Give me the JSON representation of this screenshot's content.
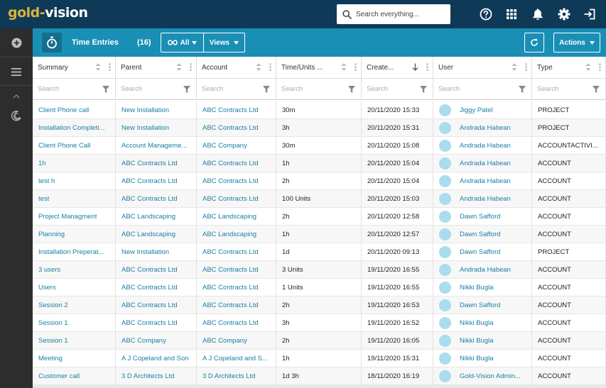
{
  "brand": {
    "part1": "gold",
    "dash": "-",
    "part2": "vision"
  },
  "search": {
    "placeholder": "Search everything..."
  },
  "topbar_icons": [
    "help-icon",
    "apps-grid-icon",
    "notifications-bell-icon",
    "settings-gear-icon",
    "logout-icon"
  ],
  "rail_icons": [
    "add-icon",
    "menu-hamburger-icon",
    "collapse-chevron-icon",
    "moon-icon"
  ],
  "header": {
    "title": "Time Entries",
    "count": "(16)",
    "filter_label": "All",
    "views_label": "Views",
    "actions_label": "Actions"
  },
  "columns": [
    {
      "key": "summary",
      "label": "Summary",
      "filter_placeholder": "Search"
    },
    {
      "key": "parent",
      "label": "Parent",
      "filter_placeholder": "Search"
    },
    {
      "key": "account",
      "label": "Account",
      "filter_placeholder": "Search"
    },
    {
      "key": "units",
      "label": "Time/Units ...",
      "filter_placeholder": "Search"
    },
    {
      "key": "created",
      "label": "Create...",
      "filter_placeholder": "Search",
      "sorted": "desc"
    },
    {
      "key": "user",
      "label": "User",
      "filter_placeholder": "Search"
    },
    {
      "key": "type",
      "label": "Type",
      "filter_placeholder": "Search"
    }
  ],
  "rows": [
    {
      "summary": "Client Phone call",
      "parent": "New Installation",
      "account": "ABC Contracts Ltd",
      "units": "30m",
      "created": "20/11/2020 15:33",
      "user": "Jiggy Patel",
      "type": "PROJECT"
    },
    {
      "summary": "Installation Completi...",
      "parent": "New Installation",
      "account": "ABC Contracts Ltd",
      "units": "3h",
      "created": "20/11/2020 15:31",
      "user": "Andrada Habean",
      "type": "PROJECT"
    },
    {
      "summary": "Client Phone Call",
      "parent": "Account Manageme...",
      "account": "ABC Company",
      "units": "30m",
      "created": "20/11/2020 15:08",
      "user": "Andrada Habean",
      "type": "ACCOUNTACTIVI..."
    },
    {
      "summary": "1h",
      "parent": "ABC Contracts Ltd",
      "account": "ABC Contracts Ltd",
      "units": "1h",
      "created": "20/11/2020 15:04",
      "user": "Andrada Habean",
      "type": "ACCOUNT"
    },
    {
      "summary": "test h",
      "parent": "ABC Contracts Ltd",
      "account": "ABC Contracts Ltd",
      "units": "2h",
      "created": "20/11/2020 15:04",
      "user": "Andrada Habean",
      "type": "ACCOUNT"
    },
    {
      "summary": "test",
      "parent": "ABC Contracts Ltd",
      "account": "ABC Contracts Ltd",
      "units": "100 Units",
      "created": "20/11/2020 15:03",
      "user": "Andrada Habean",
      "type": "ACCOUNT"
    },
    {
      "summary": "Project Managment",
      "parent": "ABC Landscaping",
      "account": "ABC Landscaping",
      "units": "2h",
      "created": "20/11/2020 12:58",
      "user": "Dawn Safford",
      "type": "ACCOUNT"
    },
    {
      "summary": "Planning",
      "parent": "ABC Landscaping",
      "account": "ABC Landscaping",
      "units": "1h",
      "created": "20/11/2020 12:57",
      "user": "Dawn Safford",
      "type": "ACCOUNT"
    },
    {
      "summary": "Installation Preperat...",
      "parent": "New Installation",
      "account": "ABC Contracts Ltd",
      "units": "1d",
      "created": "20/11/2020 09:13",
      "user": "Dawn Safford",
      "type": "PROJECT"
    },
    {
      "summary": "3 users",
      "parent": "ABC Contracts Ltd",
      "account": "ABC Contracts Ltd",
      "units": "3 Units",
      "created": "19/11/2020 16:55",
      "user": "Andrada Habean",
      "type": "ACCOUNT"
    },
    {
      "summary": "Users",
      "parent": "ABC Contracts Ltd",
      "account": "ABC Contracts Ltd",
      "units": "1 Units",
      "created": "19/11/2020 16:55",
      "user": "Nikki Bugla",
      "type": "ACCOUNT"
    },
    {
      "summary": "Session 2",
      "parent": "ABC Contracts Ltd",
      "account": "ABC Contracts Ltd",
      "units": "2h",
      "created": "19/11/2020 16:53",
      "user": "Dawn Safford",
      "type": "ACCOUNT"
    },
    {
      "summary": "Session 1",
      "parent": "ABC Contracts Ltd",
      "account": "ABC Contracts Ltd",
      "units": "3h",
      "created": "19/11/2020 16:52",
      "user": "Nikki Bugla",
      "type": "ACCOUNT"
    },
    {
      "summary": "Session 1",
      "parent": "ABC Company",
      "account": "ABC Company",
      "units": "2h",
      "created": "19/11/2020 16:05",
      "user": "Nikki Bugla",
      "type": "ACCOUNT"
    },
    {
      "summary": "Meeting",
      "parent": "A J Copeland and Son",
      "account": "A J Copeland and S...",
      "units": "1h",
      "created": "19/11/2020 15:31",
      "user": "Nikki Bugla",
      "type": "ACCOUNT"
    },
    {
      "summary": "Customer call",
      "parent": "3 D Architects Ltd",
      "account": "3 D Architects Ltd",
      "units": "1d 3h",
      "created": "18/11/2020 16:19",
      "user": "Gold-Vision Admin...",
      "type": "ACCOUNT"
    }
  ],
  "colors": {
    "topbar": "#0f3a57",
    "header": "#1a8fb5",
    "rail": "#2d2d2d",
    "link": "#1a7fa3",
    "brand_gold": "#d8b23c",
    "avatar": "#a9dcef"
  }
}
